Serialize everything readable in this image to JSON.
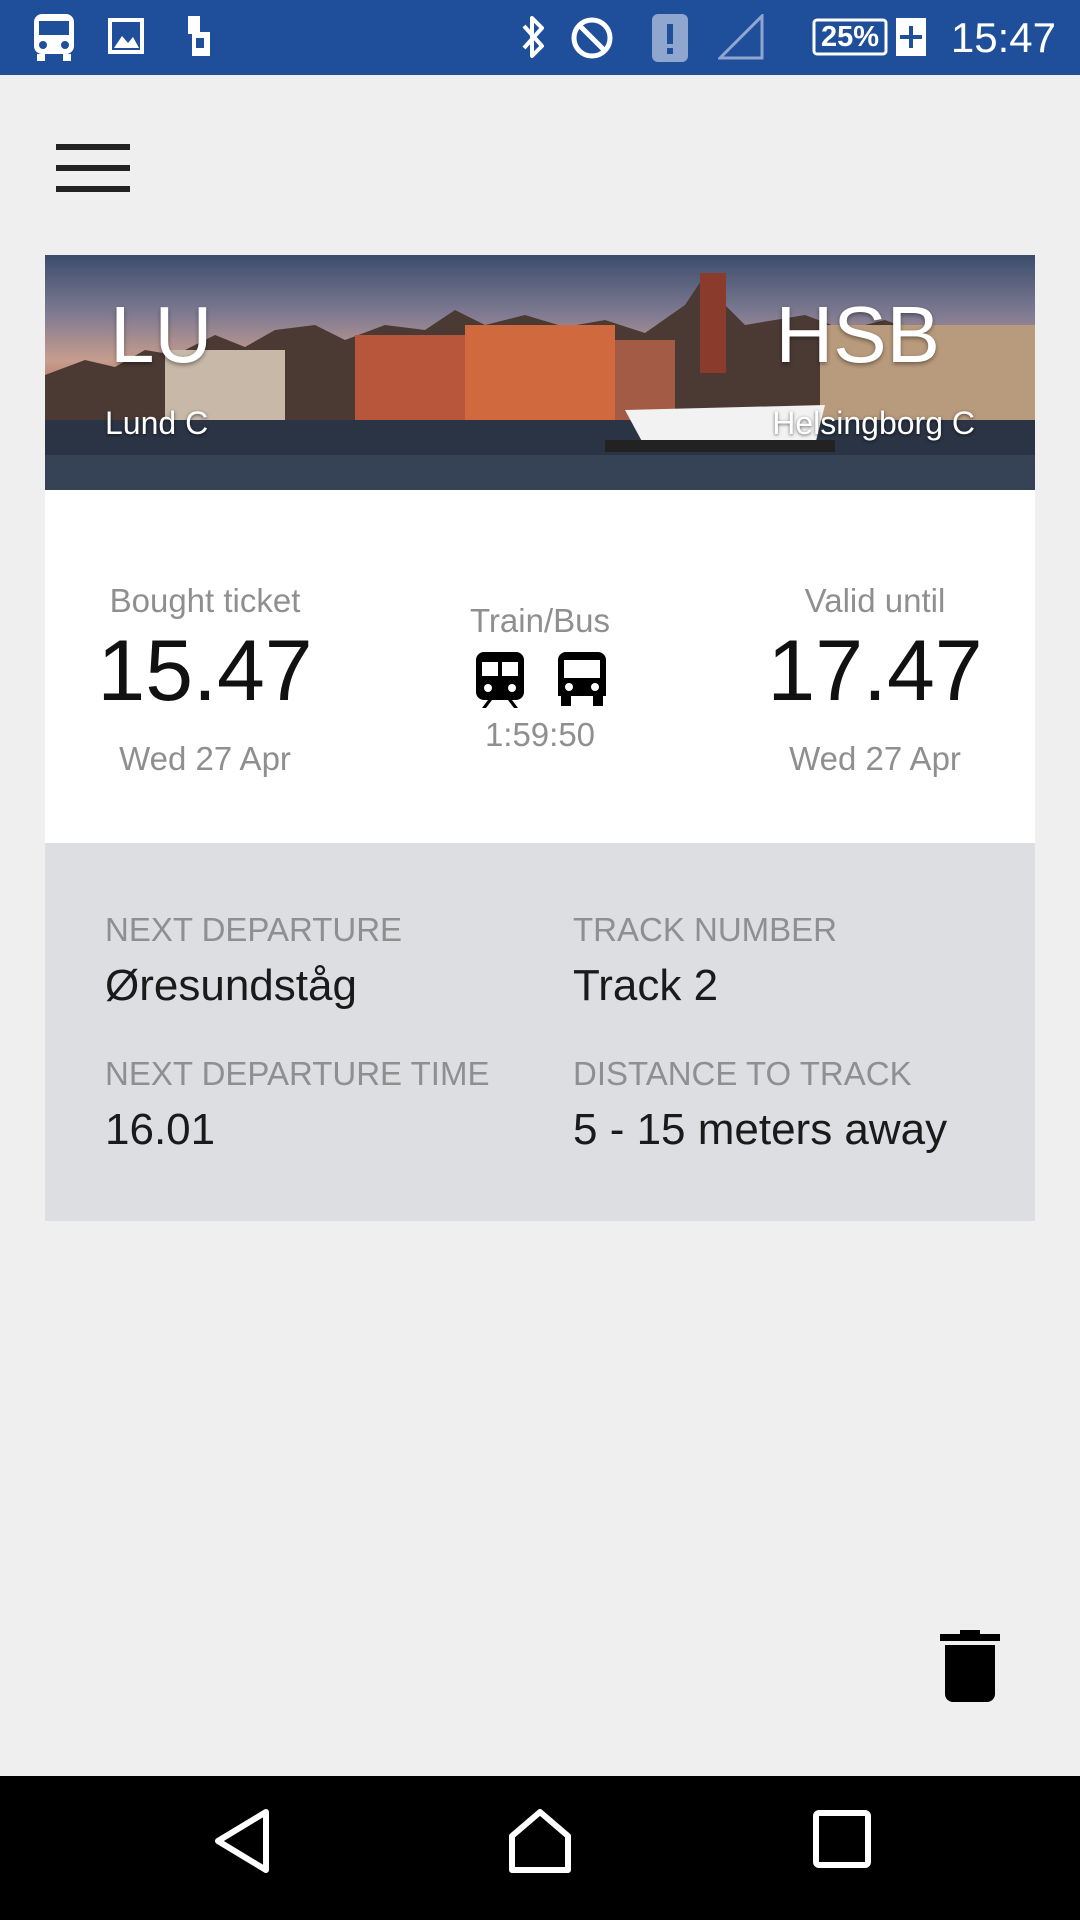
{
  "status_bar": {
    "time": "15:47",
    "battery": "25%",
    "icons": [
      "bus-notification-icon",
      "image-notification-icon",
      "sim-icon",
      "bluetooth-icon",
      "do-not-disturb-icon",
      "alert-icon",
      "signal-icon",
      "battery-charging-icon"
    ]
  },
  "header": {
    "menu_icon": "hamburger-menu-icon"
  },
  "route": {
    "from_code": "LU",
    "from_name": "Lund C",
    "to_code": "HSB",
    "to_name": "Helsingborg C"
  },
  "ticket": {
    "bought_label": "Bought ticket",
    "bought_time": "15.47",
    "bought_date": "Wed 27 Apr",
    "mode_label": "Train/Bus",
    "mode_icons": [
      "train-icon",
      "bus-icon"
    ],
    "countdown": "1:59:50",
    "valid_label": "Valid until",
    "valid_time": "17.47",
    "valid_date": "Wed 27 Apr"
  },
  "departure": {
    "next_departure_label": "NEXT DEPARTURE",
    "next_departure_value": "Øresundståg",
    "track_label": "TRACK NUMBER",
    "track_value": "Track 2",
    "time_label": "NEXT DEPARTURE TIME",
    "time_value": "16.01",
    "distance_label": "DISTANCE TO TRACK",
    "distance_value": "5 - 15 meters away"
  },
  "actions": {
    "delete_icon": "trash-icon"
  },
  "nav": {
    "icons": [
      "back-icon",
      "home-icon",
      "recents-icon"
    ]
  },
  "colors": {
    "status_bar": "#1f4e9a",
    "details_bg": "#dcdee2",
    "background": "#efefef"
  }
}
